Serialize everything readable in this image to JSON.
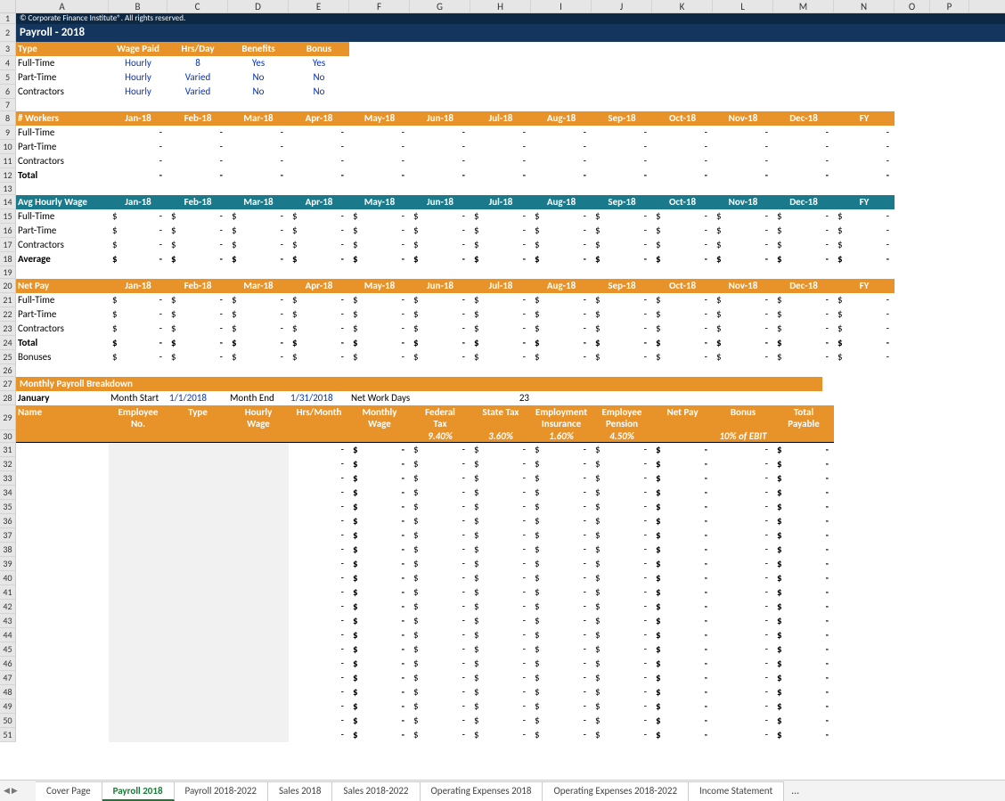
{
  "cols": [
    "A",
    "B",
    "C",
    "D",
    "E",
    "F",
    "G",
    "H",
    "I",
    "J",
    "K",
    "L",
    "M",
    "N",
    "O",
    "P"
  ],
  "copyright": "© Corporate Finance Institute®. All rights reserved.",
  "title": "Payroll - 2018",
  "typeHeaders": [
    "Type",
    "Wage Paid",
    "Hrs/Day",
    "Benefits",
    "Bonus"
  ],
  "typeRows": [
    {
      "t": "Full-Time",
      "w": "Hourly",
      "h": "8",
      "b": "Yes",
      "bo": "Yes"
    },
    {
      "t": "Part-Time",
      "w": "Hourly",
      "h": "Varied",
      "b": "No",
      "bo": "No"
    },
    {
      "t": "Contractors",
      "w": "Hourly",
      "h": "Varied",
      "b": "No",
      "bo": "No"
    }
  ],
  "months": [
    "Jan-18",
    "Feb-18",
    "Mar-18",
    "Apr-18",
    "May-18",
    "Jun-18",
    "Jul-18",
    "Aug-18",
    "Sep-18",
    "Oct-18",
    "Nov-18",
    "Dec-18",
    "FY"
  ],
  "workersLabel": "# Workers",
  "workerRows": [
    "Full-Time",
    "Part-Time",
    "Contractors",
    "Total"
  ],
  "avgLabel": "Avg Hourly Wage",
  "avgRows": [
    "Full-Time",
    "Part-Time",
    "Contractors",
    "Average"
  ],
  "netLabel": "Net Pay",
  "netRows": [
    "Full-Time",
    "Part-Time",
    "Contractors",
    "Total",
    "Bonuses"
  ],
  "dollar": "$",
  "dash": "-",
  "breakdownTitle": "Monthly Payroll Breakdown",
  "jan": "January",
  "monthStartLbl": "Month Start",
  "monthStartVal": "1/1/2018",
  "monthEndLbl": "Month End",
  "monthEndVal": "1/31/2018",
  "netWorkLbl": "Net Work Days",
  "netWorkVal": "23",
  "bkHeaders": {
    "name": "Name",
    "empNo": "Employee No.",
    "type": "Type",
    "hourlyWage": "Hourly Wage",
    "hrsMonth": "Hrs/Month",
    "monthlyWage": "Monthly Wage",
    "fedTax": "Federal Tax",
    "fedPct": "9.40%",
    "stateTax": "State Tax",
    "statePct": "3.60%",
    "empIns": "Employment Insurance",
    "insPct": "1.60%",
    "empPen": "Employee Pension",
    "penPct": "4.50%",
    "netPay": "Net Pay",
    "bonus": "Bonus",
    "bonusNote": "10% of EBIT",
    "totalPay": "Total Payable"
  },
  "tabs": [
    "Cover Page",
    "Payroll 2018",
    "Payroll 2018-2022",
    "Sales 2018",
    "Sales 2018-2022",
    "Operating Expenses 2018",
    "Operating Expenses 2018-2022",
    "Income Statement"
  ],
  "activeTab": 1,
  "ellipsis": "..."
}
